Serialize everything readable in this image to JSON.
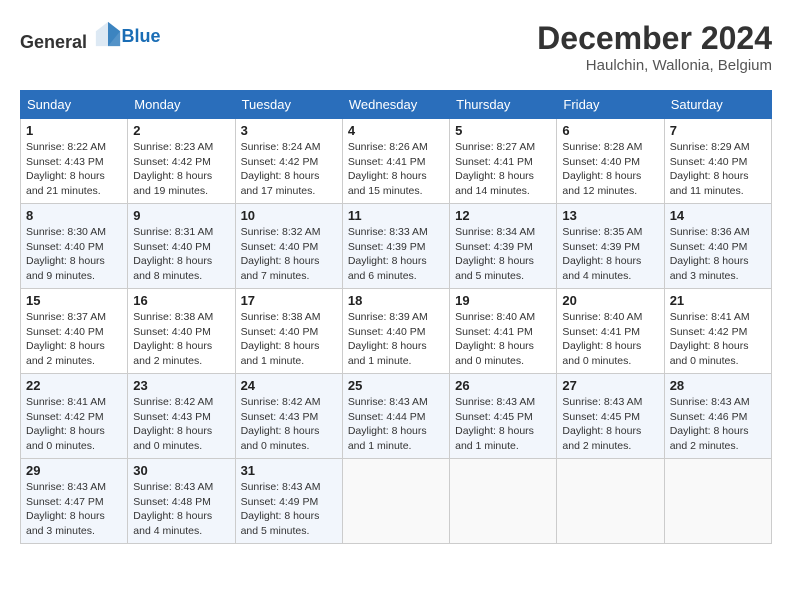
{
  "header": {
    "logo": {
      "general": "General",
      "blue": "Blue"
    },
    "month_year": "December 2024",
    "location": "Haulchin, Wallonia, Belgium"
  },
  "weekdays": [
    "Sunday",
    "Monday",
    "Tuesday",
    "Wednesday",
    "Thursday",
    "Friday",
    "Saturday"
  ],
  "weeks": [
    [
      {
        "day": "1",
        "sunrise": "8:22 AM",
        "sunset": "4:43 PM",
        "daylight": "8 hours and 21 minutes."
      },
      {
        "day": "2",
        "sunrise": "8:23 AM",
        "sunset": "4:42 PM",
        "daylight": "8 hours and 19 minutes."
      },
      {
        "day": "3",
        "sunrise": "8:24 AM",
        "sunset": "4:42 PM",
        "daylight": "8 hours and 17 minutes."
      },
      {
        "day": "4",
        "sunrise": "8:26 AM",
        "sunset": "4:41 PM",
        "daylight": "8 hours and 15 minutes."
      },
      {
        "day": "5",
        "sunrise": "8:27 AM",
        "sunset": "4:41 PM",
        "daylight": "8 hours and 14 minutes."
      },
      {
        "day": "6",
        "sunrise": "8:28 AM",
        "sunset": "4:40 PM",
        "daylight": "8 hours and 12 minutes."
      },
      {
        "day": "7",
        "sunrise": "8:29 AM",
        "sunset": "4:40 PM",
        "daylight": "8 hours and 11 minutes."
      }
    ],
    [
      {
        "day": "8",
        "sunrise": "8:30 AM",
        "sunset": "4:40 PM",
        "daylight": "8 hours and 9 minutes."
      },
      {
        "day": "9",
        "sunrise": "8:31 AM",
        "sunset": "4:40 PM",
        "daylight": "8 hours and 8 minutes."
      },
      {
        "day": "10",
        "sunrise": "8:32 AM",
        "sunset": "4:40 PM",
        "daylight": "8 hours and 7 minutes."
      },
      {
        "day": "11",
        "sunrise": "8:33 AM",
        "sunset": "4:39 PM",
        "daylight": "8 hours and 6 minutes."
      },
      {
        "day": "12",
        "sunrise": "8:34 AM",
        "sunset": "4:39 PM",
        "daylight": "8 hours and 5 minutes."
      },
      {
        "day": "13",
        "sunrise": "8:35 AM",
        "sunset": "4:39 PM",
        "daylight": "8 hours and 4 minutes."
      },
      {
        "day": "14",
        "sunrise": "8:36 AM",
        "sunset": "4:40 PM",
        "daylight": "8 hours and 3 minutes."
      }
    ],
    [
      {
        "day": "15",
        "sunrise": "8:37 AM",
        "sunset": "4:40 PM",
        "daylight": "8 hours and 2 minutes."
      },
      {
        "day": "16",
        "sunrise": "8:38 AM",
        "sunset": "4:40 PM",
        "daylight": "8 hours and 2 minutes."
      },
      {
        "day": "17",
        "sunrise": "8:38 AM",
        "sunset": "4:40 PM",
        "daylight": "8 hours and 1 minute."
      },
      {
        "day": "18",
        "sunrise": "8:39 AM",
        "sunset": "4:40 PM",
        "daylight": "8 hours and 1 minute."
      },
      {
        "day": "19",
        "sunrise": "8:40 AM",
        "sunset": "4:41 PM",
        "daylight": "8 hours and 0 minutes."
      },
      {
        "day": "20",
        "sunrise": "8:40 AM",
        "sunset": "4:41 PM",
        "daylight": "8 hours and 0 minutes."
      },
      {
        "day": "21",
        "sunrise": "8:41 AM",
        "sunset": "4:42 PM",
        "daylight": "8 hours and 0 minutes."
      }
    ],
    [
      {
        "day": "22",
        "sunrise": "8:41 AM",
        "sunset": "4:42 PM",
        "daylight": "8 hours and 0 minutes."
      },
      {
        "day": "23",
        "sunrise": "8:42 AM",
        "sunset": "4:43 PM",
        "daylight": "8 hours and 0 minutes."
      },
      {
        "day": "24",
        "sunrise": "8:42 AM",
        "sunset": "4:43 PM",
        "daylight": "8 hours and 0 minutes."
      },
      {
        "day": "25",
        "sunrise": "8:43 AM",
        "sunset": "4:44 PM",
        "daylight": "8 hours and 1 minute."
      },
      {
        "day": "26",
        "sunrise": "8:43 AM",
        "sunset": "4:45 PM",
        "daylight": "8 hours and 1 minute."
      },
      {
        "day": "27",
        "sunrise": "8:43 AM",
        "sunset": "4:45 PM",
        "daylight": "8 hours and 2 minutes."
      },
      {
        "day": "28",
        "sunrise": "8:43 AM",
        "sunset": "4:46 PM",
        "daylight": "8 hours and 2 minutes."
      }
    ],
    [
      {
        "day": "29",
        "sunrise": "8:43 AM",
        "sunset": "4:47 PM",
        "daylight": "8 hours and 3 minutes."
      },
      {
        "day": "30",
        "sunrise": "8:43 AM",
        "sunset": "4:48 PM",
        "daylight": "8 hours and 4 minutes."
      },
      {
        "day": "31",
        "sunrise": "8:43 AM",
        "sunset": "4:49 PM",
        "daylight": "8 hours and 5 minutes."
      },
      null,
      null,
      null,
      null
    ]
  ]
}
